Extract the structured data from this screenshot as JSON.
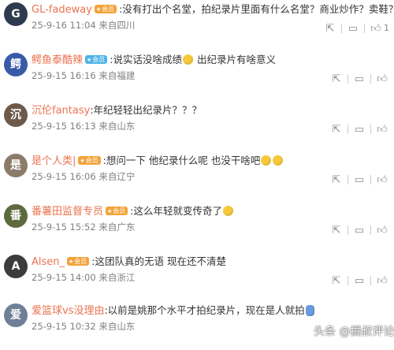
{
  "comments": [
    {
      "user": "GL-fadeway",
      "badge": "会员",
      "badge_color": "orange",
      "text": ":没有打出个名堂，拍纪录片里面有什么名堂？商业炒作？卖鞋？",
      "emojis": [],
      "date": "25-9-16 11:04",
      "location": "来自四川",
      "likes": "1",
      "avatar_color": "#2e3b4f",
      "avatar_glyph": "G"
    },
    {
      "user": "鳄鱼泰酷辣",
      "badge": "会员",
      "badge_color": "blue",
      "text": ":说实话没啥成绩",
      "emojis": [
        "thinking-emoji"
      ],
      "text_after": " 出纪录片有啥意义",
      "date": "25-9-15 16:16",
      "location": "来自福建",
      "likes": "",
      "avatar_color": "#3a5aa8",
      "avatar_glyph": "鳄"
    },
    {
      "user": "沉伦fantasy",
      "badge": "",
      "badge_color": "",
      "text": ":年纪轻轻出纪录片？？？",
      "emojis": [],
      "date": "25-9-15 16:13",
      "location": "来自山东",
      "likes": "",
      "avatar_color": "#6e5a4a",
      "avatar_glyph": "沉"
    },
    {
      "user": "是个人类|",
      "badge": "会员",
      "badge_color": "orange",
      "text": ":想问一下 他纪录什么呢 也没干啥吧",
      "emojis": [
        "sweat-emoji",
        "sweat-emoji"
      ],
      "date": "25-9-15 16:06",
      "location": "来自辽宁",
      "likes": "",
      "avatar_color": "#8b7b6a",
      "avatar_glyph": "是"
    },
    {
      "user": "番薯田监督专员",
      "badge": "会员",
      "badge_color": "orange",
      "text": ":这么年轻就变传奇了",
      "emojis": [
        "face-emoji"
      ],
      "date": "25-9-15 15:52",
      "location": "来自广东",
      "likes": "",
      "avatar_color": "#5c6b3e",
      "avatar_glyph": "番"
    },
    {
      "user": "Alsen_",
      "badge": "会员",
      "badge_color": "orange",
      "text": ":这团队真的无语 现在还不清楚",
      "emojis": [],
      "date": "25-9-15 14:00",
      "location": "来自浙江",
      "likes": "",
      "avatar_color": "#3c3c3c",
      "avatar_glyph": "A"
    },
    {
      "user": "爱篮球vs没理由",
      "badge": "",
      "badge_color": "",
      "text": ":以前是姚那个水平才拍纪录片，现在是人就拍",
      "emojis": [
        "thumb-emoji"
      ],
      "date": "25-9-15 10:32",
      "location": "来自山东",
      "likes": "",
      "avatar_color": "#6f7f96",
      "avatar_glyph": "爱"
    }
  ],
  "watermark": "头条 @掘叔评论"
}
